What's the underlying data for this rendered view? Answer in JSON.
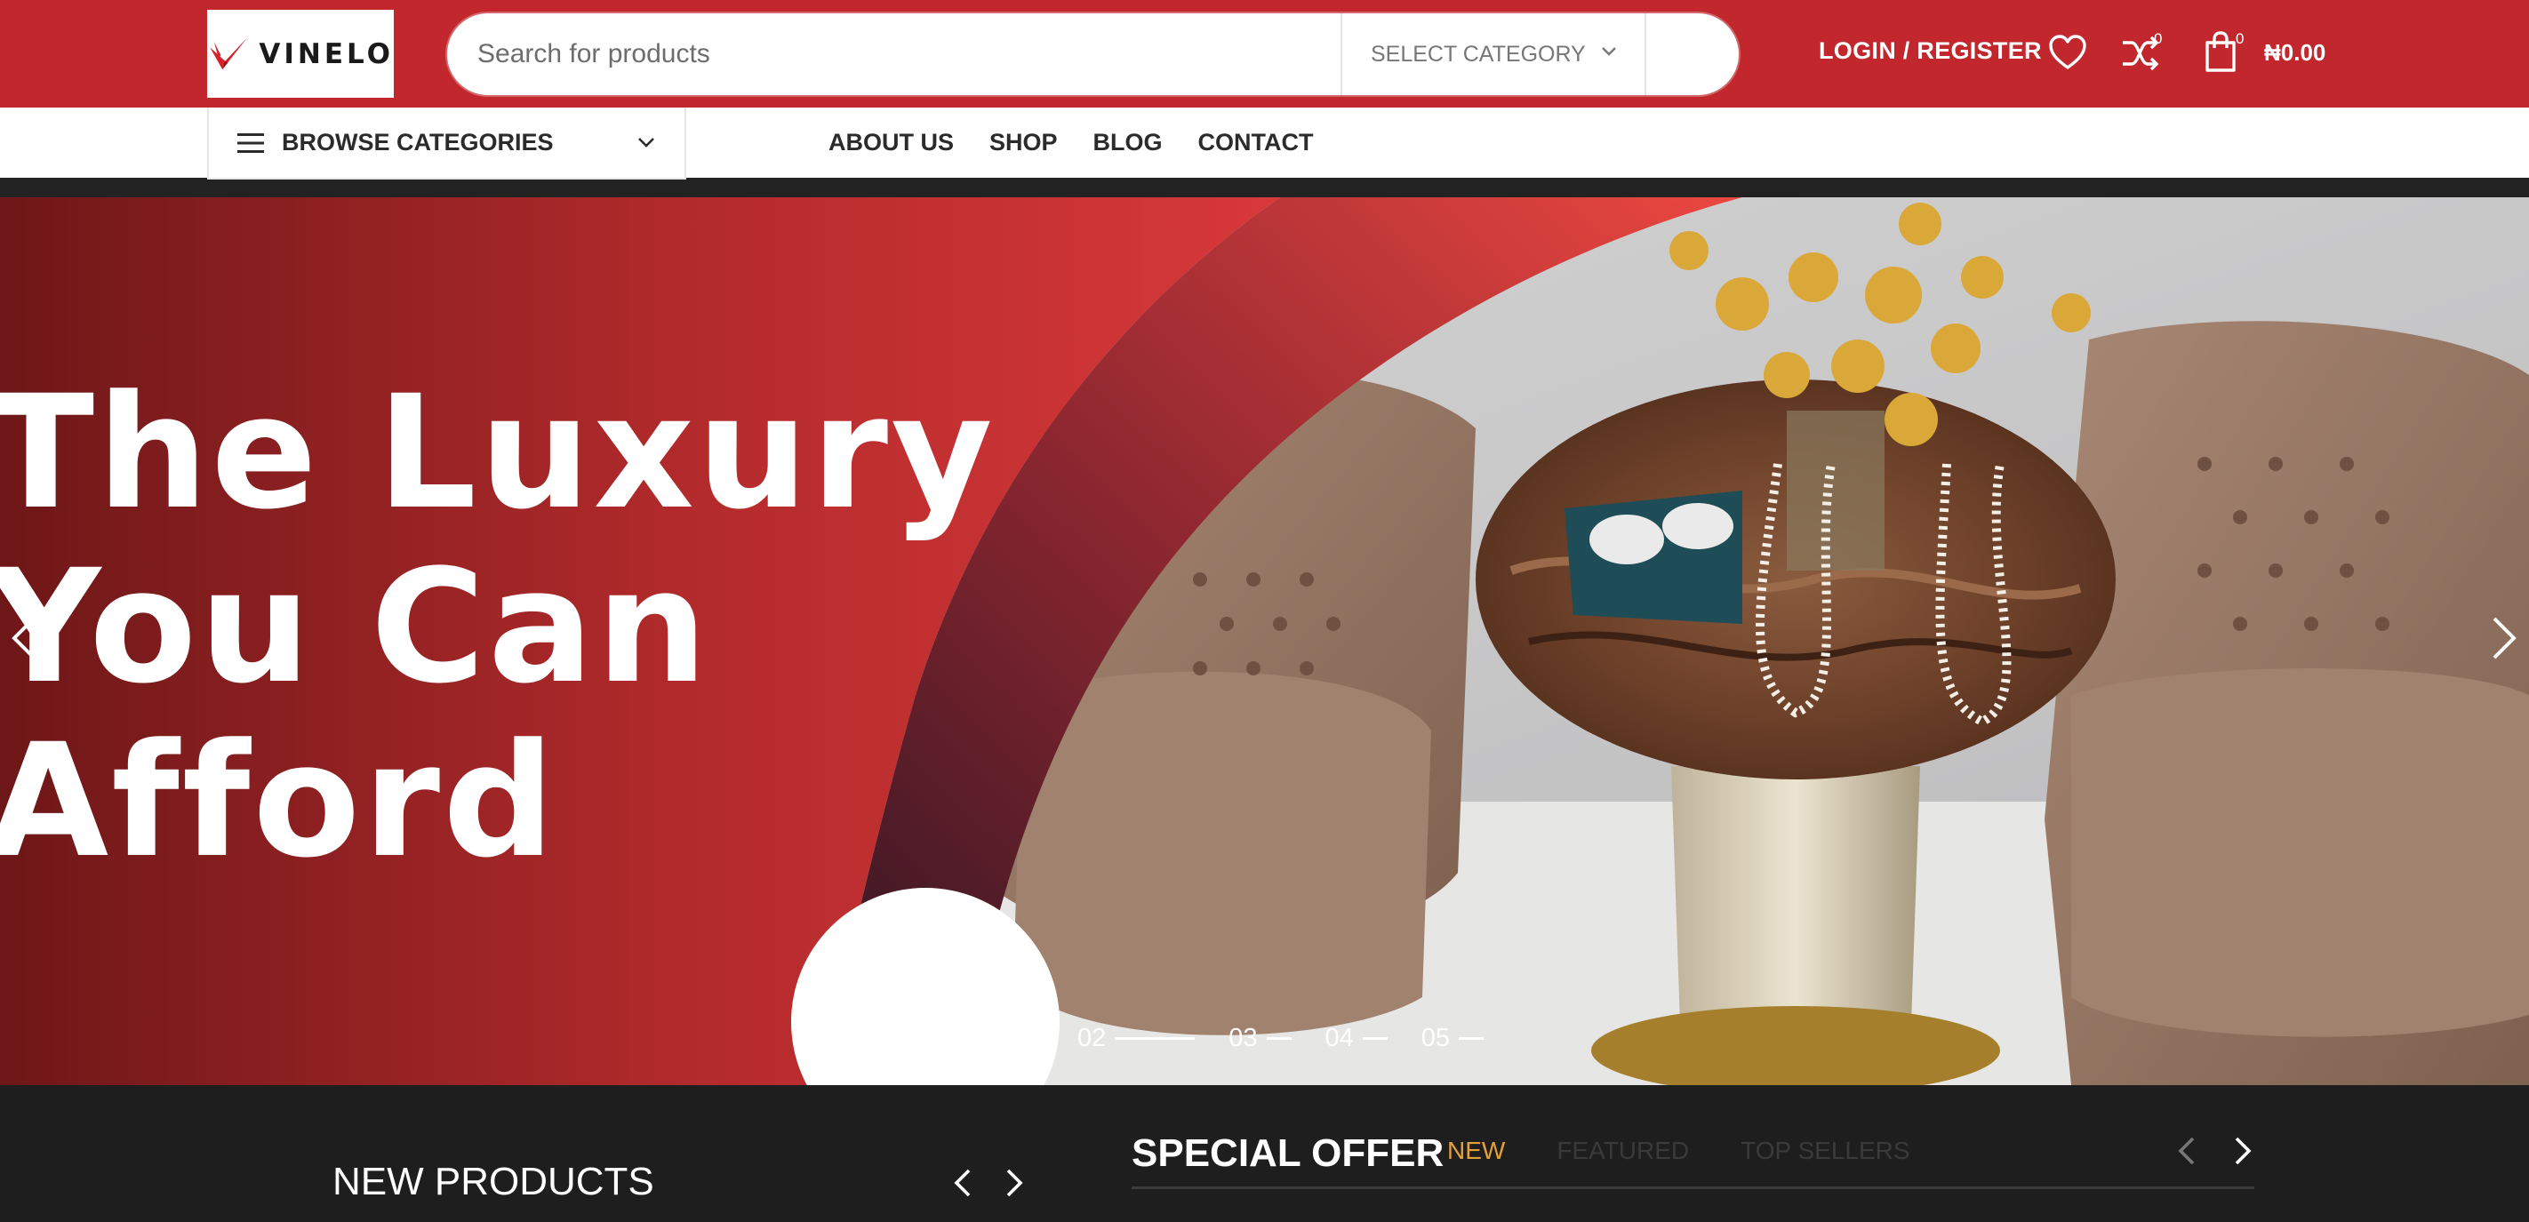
{
  "header": {
    "logo_text": "VINELO",
    "search": {
      "placeholder": "Search for products",
      "category_label": "SELECT CATEGORY"
    },
    "login_label": "LOGIN / REGISTER",
    "compare_count": "0",
    "cart_count": "0",
    "cart_total": "₦0.00",
    "icons": [
      "heart-icon",
      "compare-icon",
      "cart-icon",
      "chevron-down-icon"
    ],
    "brand_color": "#c1272d"
  },
  "nav": {
    "browse_label": "BROWSE CATEGORIES",
    "menu": [
      "ABOUT US",
      "SHOP",
      "BLOG",
      "CONTACT"
    ]
  },
  "hero": {
    "headline": [
      "The Luxury",
      "You Can",
      "Afford"
    ],
    "pager": [
      "02",
      "03",
      "04",
      "05"
    ]
  },
  "lower": {
    "new_products_title": "NEW PRODUCTS",
    "special_offer_title": "SPECIAL OFFER",
    "tabs": [
      "NEW",
      "FEATURED",
      "TOP SELLERS"
    ],
    "active_tab": "NEW",
    "active_color": "#e4a13a"
  }
}
